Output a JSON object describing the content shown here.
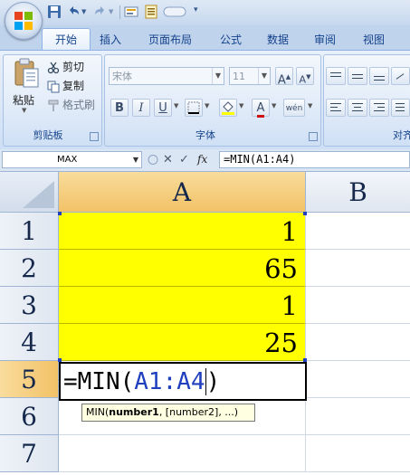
{
  "quick_access": {
    "icons": [
      "save-icon",
      "undo-icon",
      "redo-icon",
      "custom-icon-1",
      "custom-icon-2",
      "custom-icon-3",
      "customize-dropdown-icon"
    ]
  },
  "ribbon": {
    "tabs": [
      {
        "label": "开始",
        "active": true
      },
      {
        "label": "插入"
      },
      {
        "label": "页面布局"
      },
      {
        "label": "公式"
      },
      {
        "label": "数据"
      },
      {
        "label": "审阅"
      },
      {
        "label": "视图"
      }
    ],
    "clipboard": {
      "paste_label": "粘贴",
      "cut_label": "剪切",
      "copy_label": "复制",
      "format_painter_label": "格式刷",
      "group_label": "剪贴板"
    },
    "font": {
      "font_name": "宋体",
      "font_size": "11",
      "bold": "B",
      "italic": "I",
      "underline": "U",
      "grow": "A",
      "shrink": "A",
      "font_color_letter": "A",
      "phonetic": "wén",
      "group_label": "字体"
    },
    "alignment": {
      "group_label": "对齐"
    }
  },
  "formula_bar": {
    "name_box": "MAX",
    "cancel": "✕",
    "enter": "✓",
    "fx": "fx",
    "formula": "=MIN(A1:A4)"
  },
  "sheet": {
    "columns": [
      "A",
      "B"
    ],
    "rows": [
      "1",
      "2",
      "3",
      "4",
      "5",
      "6",
      "7"
    ],
    "cells": [
      {
        "ref": "A1",
        "value": "1"
      },
      {
        "ref": "A2",
        "value": "65"
      },
      {
        "ref": "A3",
        "value": "1"
      },
      {
        "ref": "A4",
        "value": "25"
      }
    ],
    "editing": {
      "ref": "A5",
      "prefix": "=MIN(",
      "range": "A1:A4",
      "suffix": ")"
    },
    "tooltip": {
      "func": "MIN(",
      "arg1": "number1",
      "rest": ", [number2], ...)"
    }
  },
  "colors": {
    "highlight": "#ffff00",
    "range_ref": "#1f3fbf",
    "tab_text": "#15428b"
  }
}
